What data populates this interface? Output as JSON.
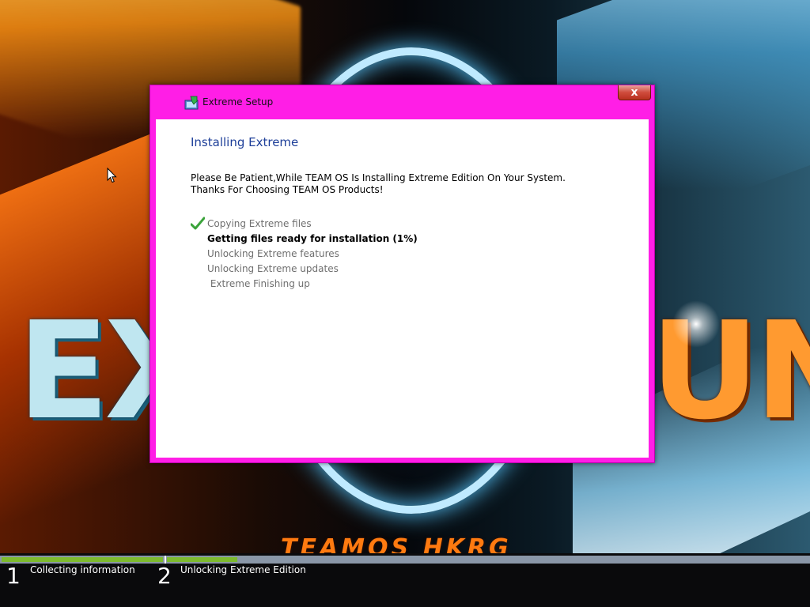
{
  "dialog": {
    "title": "Extreme Setup",
    "close_label": "x",
    "heading": "Installing Extreme",
    "description": "Please Be Patient,While TEAM OS Is Installing Extreme Edition On Your System. Thanks For Choosing TEAM OS Products!",
    "steps": [
      {
        "label": "Copying Extreme files",
        "status": "done"
      },
      {
        "label": "Getting files ready for installation (1%)",
        "status": "active"
      },
      {
        "label": "Unlocking Extreme features",
        "status": "pending"
      },
      {
        "label": "Unlocking Extreme updates",
        "status": "pending"
      },
      {
        "label": " Extreme Finishing up",
        "status": "pending"
      }
    ]
  },
  "wallpaper": {
    "brand": "TEAMOS HKRG",
    "text_left": "EX",
    "text_right": "UN"
  },
  "progress": {
    "phase1_fraction": 1.0,
    "phase2_fraction": 0.11,
    "phases": [
      {
        "number": "1",
        "label": "Collecting information"
      },
      {
        "number": "2",
        "label": "Unlocking Extreme Edition"
      }
    ]
  },
  "colors": {
    "window_frame": "#ff1ee6",
    "heading": "#1e3f99",
    "progress_fill": "#7dba2e",
    "check": "#3aa33a"
  },
  "icons": {
    "app": "setup-icon",
    "check": "checkmark-icon",
    "cursor": "mouse-cursor-icon"
  }
}
